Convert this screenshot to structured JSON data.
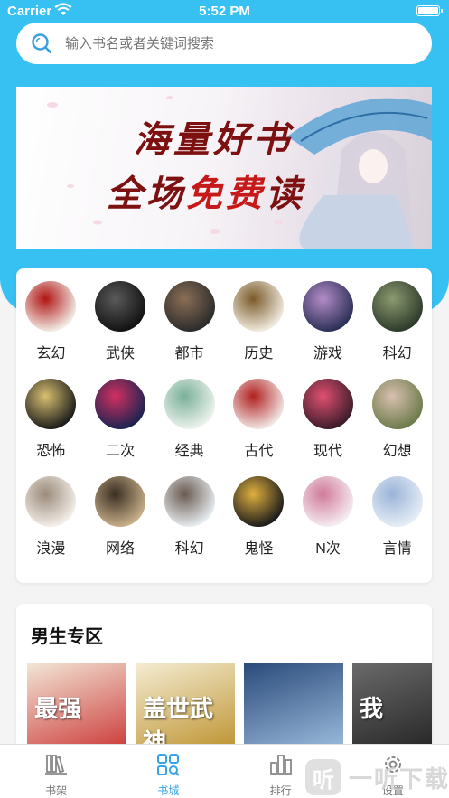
{
  "status_bar": {
    "carrier": "Carrier",
    "time": "5:52 PM"
  },
  "search": {
    "placeholder": "输入书名或者关键词搜索"
  },
  "banner": {
    "line1": "海量好书",
    "line2_a": "全场",
    "line2_b": "免费",
    "line2_c": "读"
  },
  "categories": [
    {
      "label": "玄幻",
      "colors": [
        "#f3efe8",
        "#b01414"
      ]
    },
    {
      "label": "武侠",
      "colors": [
        "#111111",
        "#5a5a5a"
      ]
    },
    {
      "label": "都市",
      "colors": [
        "#2b2b2b",
        "#8a6e55"
      ]
    },
    {
      "label": "历史",
      "colors": [
        "#f2ece1",
        "#7a5a2a"
      ]
    },
    {
      "label": "游戏",
      "colors": [
        "#2a2f55",
        "#b48cc8"
      ]
    },
    {
      "label": "科幻",
      "colors": [
        "#2d3a2a",
        "#8c9a70"
      ]
    },
    {
      "label": "恐怖",
      "colors": [
        "#1a1a1a",
        "#d8c070"
      ]
    },
    {
      "label": "二次",
      "colors": [
        "#1a2350",
        "#d23060"
      ]
    },
    {
      "label": "经典",
      "colors": [
        "#eef3ee",
        "#7ab09a"
      ]
    },
    {
      "label": "古代",
      "colors": [
        "#f2e9e6",
        "#b02020"
      ]
    },
    {
      "label": "现代",
      "colors": [
        "#3a1c2a",
        "#e05070"
      ]
    },
    {
      "label": "幻想",
      "colors": [
        "#6c7a4a",
        "#d8c0b0"
      ]
    },
    {
      "label": "浪漫",
      "colors": [
        "#f5f0ea",
        "#9a8a7a"
      ]
    },
    {
      "label": "网络",
      "colors": [
        "#c8b08a",
        "#3a2e22"
      ]
    },
    {
      "label": "科幻",
      "colors": [
        "#e8eef2",
        "#6a5a50"
      ]
    },
    {
      "label": "鬼怪",
      "colors": [
        "#1a1a1a",
        "#e0b040"
      ]
    },
    {
      "label": "N次",
      "colors": [
        "#f6eef2",
        "#d07a9a"
      ]
    },
    {
      "label": "言情",
      "colors": [
        "#e6eef6",
        "#9ab4d8"
      ]
    }
  ],
  "male_section": {
    "title": "男生专区",
    "covers": [
      {
        "text": "最强",
        "colors": [
          "#f2e6d6",
          "#c82828"
        ]
      },
      {
        "text": "盖世武神",
        "colors": [
          "#f4ecd2",
          "#b88a20"
        ]
      },
      {
        "text": "",
        "colors": [
          "#2a4a7a",
          "#a8c8e8"
        ]
      },
      {
        "text": "我",
        "colors": [
          "#6a6a6a",
          "#1a1a1a"
        ]
      }
    ]
  },
  "tabbar": {
    "tabs": [
      {
        "label": "书架",
        "icon": "bookshelf-icon"
      },
      {
        "label": "书城",
        "icon": "bookstore-icon"
      },
      {
        "label": "排行",
        "icon": "ranking-icon"
      },
      {
        "label": "设置",
        "icon": "settings-icon"
      }
    ]
  },
  "watermark": {
    "logo": "听",
    "text": "一听下载"
  },
  "colors": {
    "accent": "#37c0f2",
    "active_tab": "#37a4e8"
  }
}
